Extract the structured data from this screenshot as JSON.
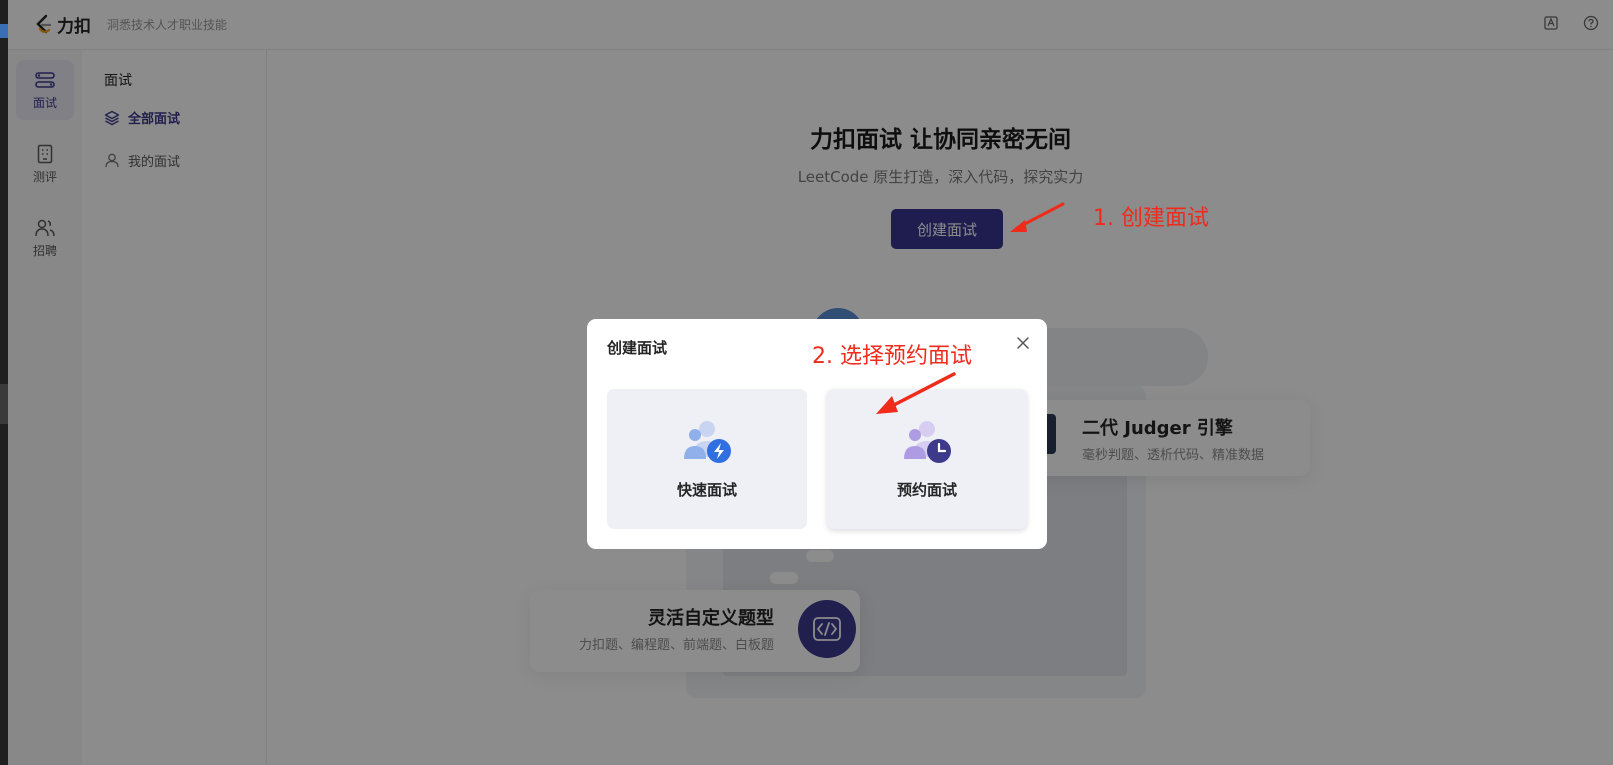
{
  "header": {
    "logo_text": "力扣",
    "slogan": "洞悉技术人才职业技能",
    "icons": [
      "feedback-icon",
      "help-icon"
    ]
  },
  "nav_rail": {
    "items": [
      {
        "label": "面试",
        "icon": "interview-icon",
        "active": true
      },
      {
        "label": "测评",
        "icon": "assessment-icon",
        "active": false
      },
      {
        "label": "招聘",
        "icon": "recruit-icon",
        "active": false
      }
    ]
  },
  "subnav": {
    "title": "面试",
    "items": [
      {
        "label": "全部面试",
        "icon": "layers-icon",
        "active": true
      },
      {
        "label": "我的面试",
        "icon": "user-icon",
        "active": false
      }
    ]
  },
  "main": {
    "title": "力扣面试 让协同亲密无间",
    "subtitle": "LeetCode 原生打造，深入代码，探究实力",
    "create_button": "创建面试",
    "features": [
      {
        "title": "二代 Judger 引擎",
        "desc": "毫秒判题、透析代码、精准数据"
      },
      {
        "title": "灵活自定义题型",
        "desc": "力扣题、编程题、前端题、白板题"
      }
    ]
  },
  "annotations": {
    "step1": "1. 创建面试",
    "step2": "2. 选择预约面试",
    "color": "#ef2b1a"
  },
  "modal": {
    "title": "创建面试",
    "options": [
      {
        "label": "快速面试",
        "icon": "quick-interview-icon"
      },
      {
        "label": "预约面试",
        "icon": "scheduled-interview-icon"
      }
    ]
  },
  "colors": {
    "brand": "#3a3591",
    "accent_light": "#eceaf5",
    "overlay": "rgba(0,0,0,0.45)"
  }
}
